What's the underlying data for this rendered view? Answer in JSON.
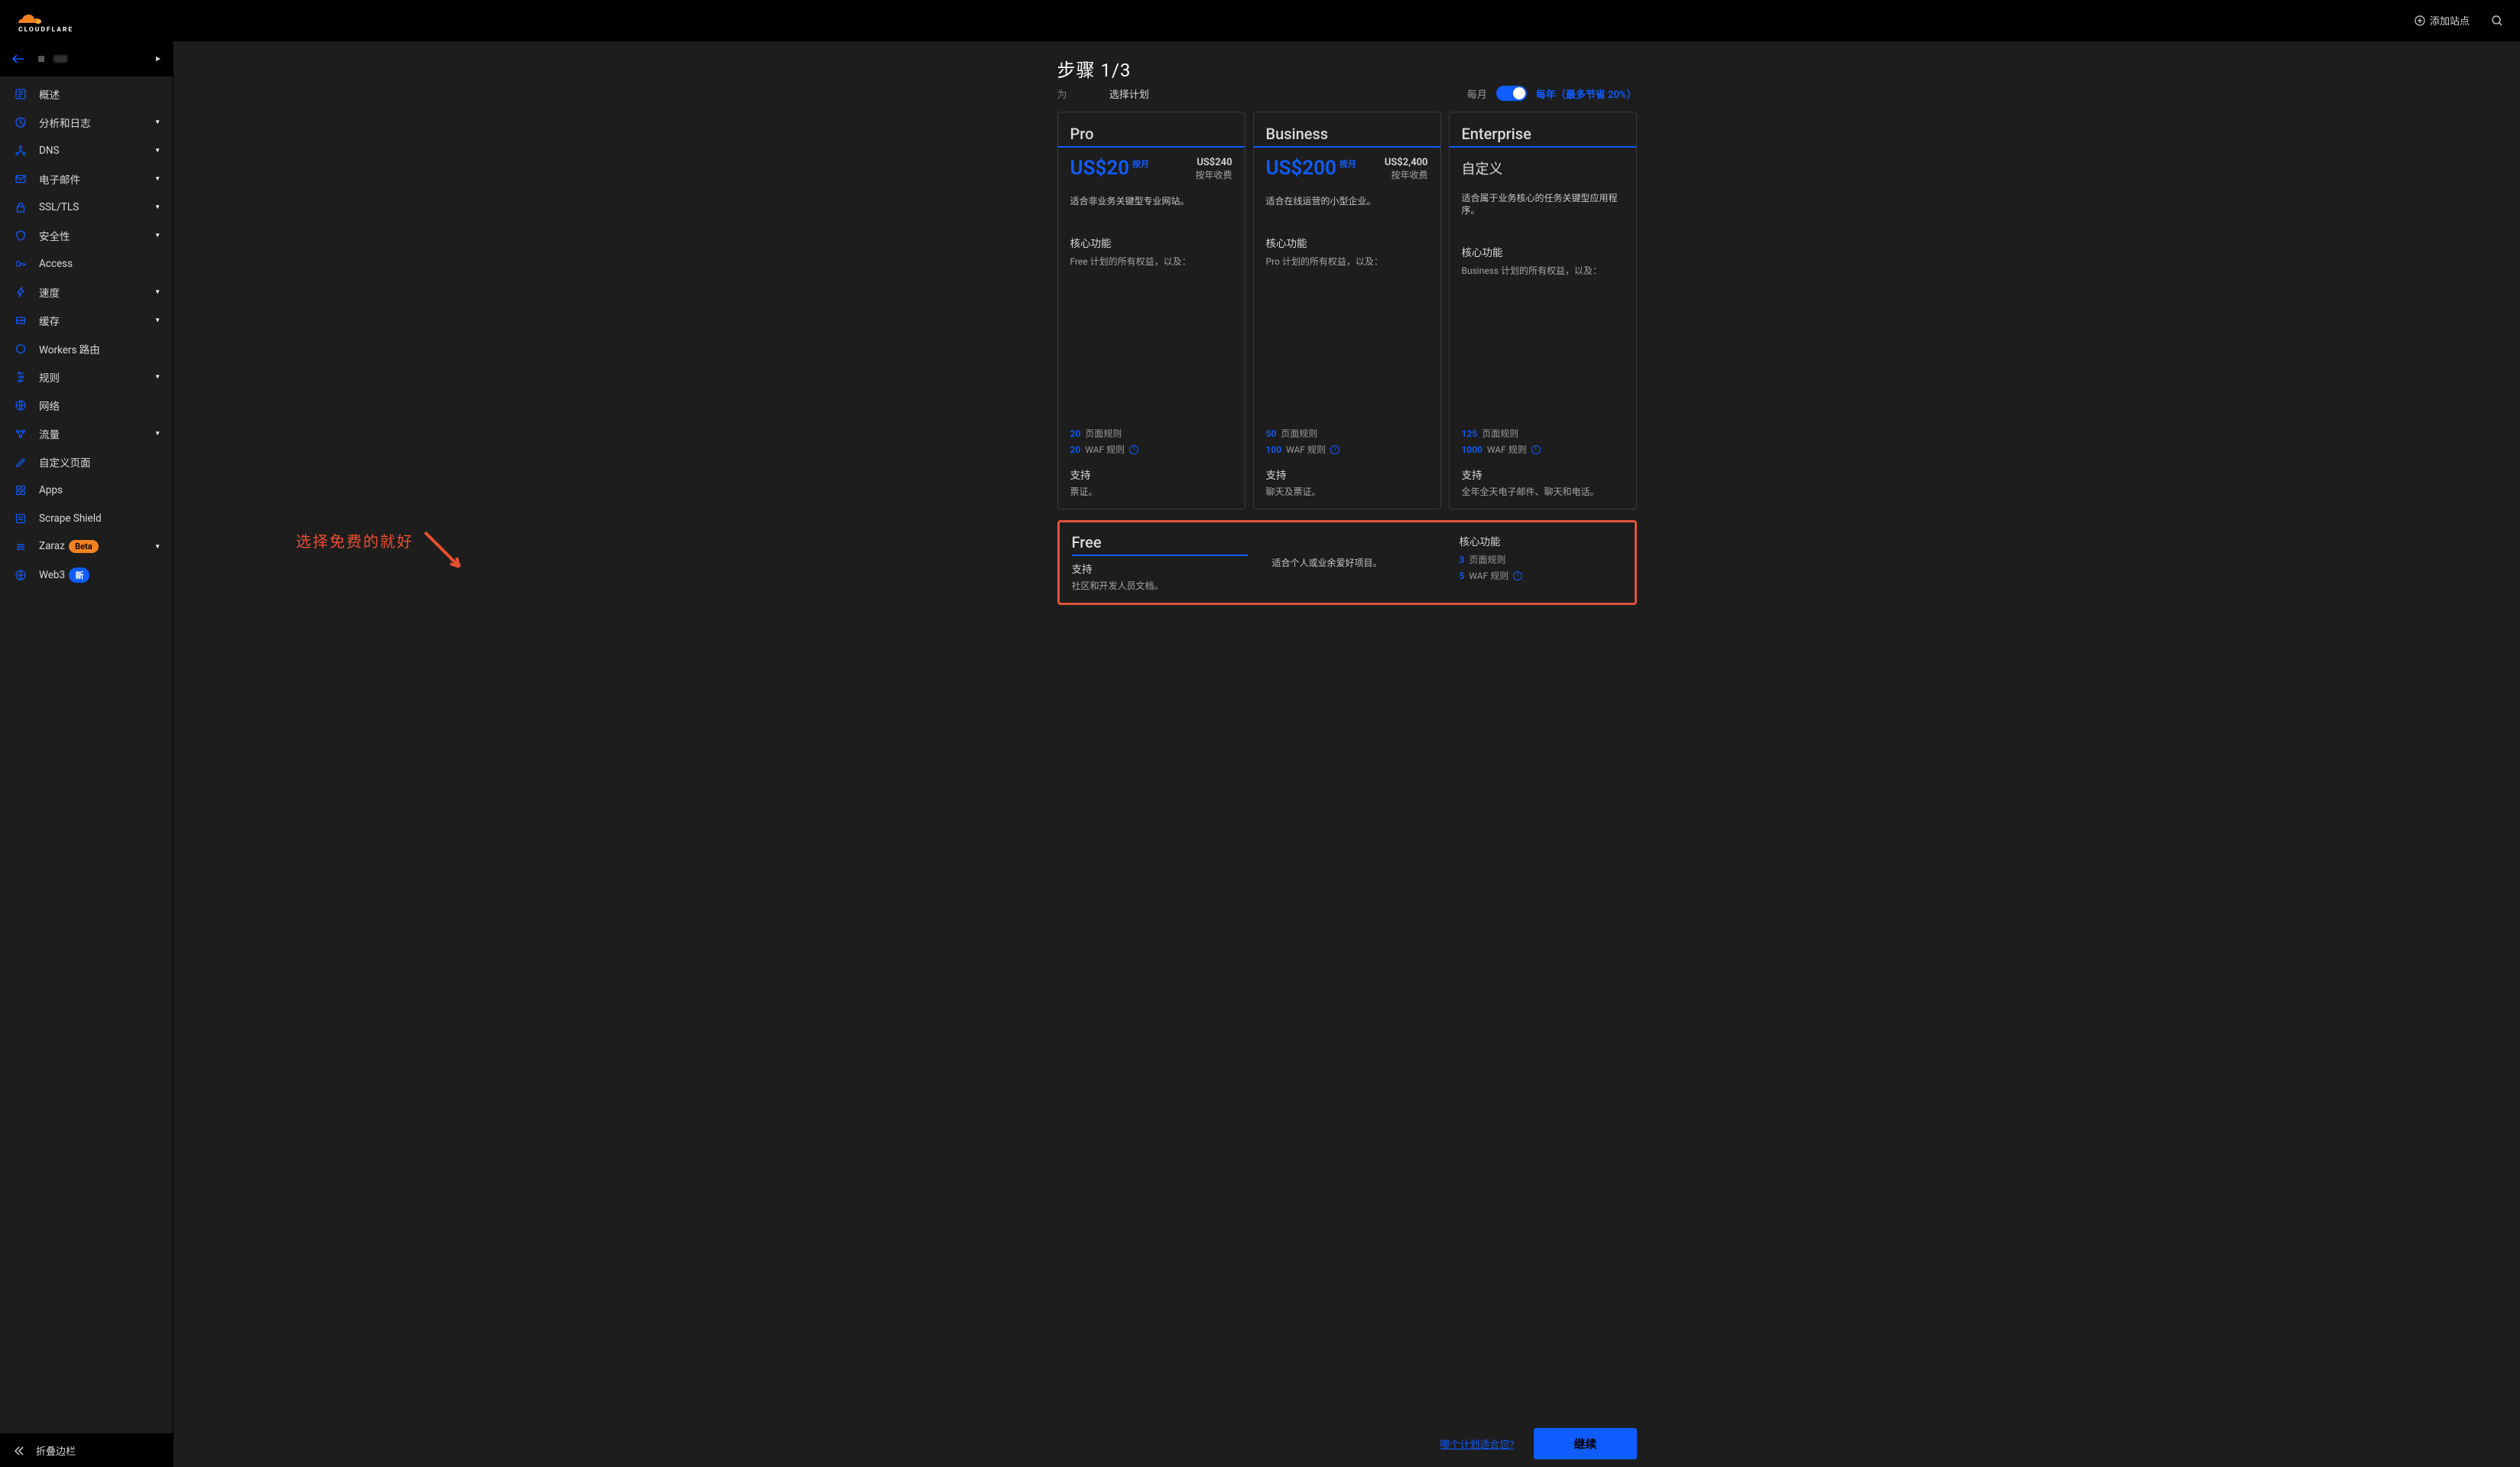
{
  "header": {
    "add_site": "添加站点"
  },
  "sidebar": {
    "items": [
      {
        "icon": "overview",
        "label": "概述",
        "expandable": false
      },
      {
        "icon": "analytics",
        "label": "分析和日志",
        "expandable": true
      },
      {
        "icon": "dns",
        "label": "DNS",
        "expandable": true
      },
      {
        "icon": "email",
        "label": "电子邮件",
        "expandable": true
      },
      {
        "icon": "lock",
        "label": "SSL/TLS",
        "expandable": true
      },
      {
        "icon": "shield",
        "label": "安全性",
        "expandable": true
      },
      {
        "icon": "access",
        "label": "Access",
        "expandable": false
      },
      {
        "icon": "speed",
        "label": "速度",
        "expandable": true
      },
      {
        "icon": "cache",
        "label": "缓存",
        "expandable": true
      },
      {
        "icon": "workers",
        "label": "Workers 路由",
        "expandable": false
      },
      {
        "icon": "rules",
        "label": "规则",
        "expandable": true
      },
      {
        "icon": "network",
        "label": "网络",
        "expandable": false
      },
      {
        "icon": "traffic",
        "label": "流量",
        "expandable": true
      },
      {
        "icon": "custom",
        "label": "自定义页面",
        "expandable": false
      },
      {
        "icon": "apps",
        "label": "Apps",
        "expandable": false
      },
      {
        "icon": "scrape",
        "label": "Scrape Shield",
        "expandable": false
      },
      {
        "icon": "zaraz",
        "label": "Zaraz",
        "expandable": true,
        "badge": "Beta",
        "badge_kind": "beta"
      },
      {
        "icon": "web3",
        "label": "Web3",
        "expandable": false,
        "badge": "新",
        "badge_kind": "new"
      }
    ],
    "collapse": "折叠边栏"
  },
  "step": {
    "title": "步骤 1/3",
    "for_label": "为",
    "select_plan": "选择计划",
    "monthly": "每月",
    "yearly": "每年（最多节省 20%）"
  },
  "plans": {
    "pro": {
      "name": "Pro",
      "price": "US$20",
      "price_unit": "按月",
      "yearly_price": "US$240",
      "yearly_note": "按年收费",
      "desc": "适合非业务关键型专业网站。",
      "core_heading": "核心功能",
      "core_sub": "Free 计划的所有权益，以及：",
      "page_rules_n": "20",
      "page_rules_l": "页面规则",
      "waf_rules_n": "20",
      "waf_rules_l": "WAF 规则",
      "support_h": "支持",
      "support_d": "票证。"
    },
    "business": {
      "name": "Business",
      "price": "US$200",
      "price_unit": "按月",
      "yearly_price": "US$2,400",
      "yearly_note": "按年收费",
      "desc": "适合在线运营的小型企业。",
      "core_heading": "核心功能",
      "core_sub": "Pro 计划的所有权益，以及：",
      "page_rules_n": "50",
      "page_rules_l": "页面规则",
      "waf_rules_n": "100",
      "waf_rules_l": "WAF 规则",
      "support_h": "支持",
      "support_d": "聊天及票证。"
    },
    "enterprise": {
      "name": "Enterprise",
      "custom": "自定义",
      "desc": "适合属于业务核心的任务关键型应用程序。",
      "core_heading": "核心功能",
      "core_sub": "Business 计划的所有权益，以及：",
      "page_rules_n": "125",
      "page_rules_l": "页面规则",
      "waf_rules_n": "1000",
      "waf_rules_l": "WAF 规则",
      "support_h": "支持",
      "support_d": "全年全天电子邮件、聊天和电话。"
    },
    "free": {
      "name": "Free",
      "desc": "适合个人或业余爱好项目。",
      "support_h": "支持",
      "support_d": "社区和开发人员文档。",
      "core_heading": "核心功能",
      "page_rules_n": "3",
      "page_rules_l": "页面规则",
      "waf_rules_n": "5",
      "waf_rules_l": "WAF 规则"
    }
  },
  "bottom": {
    "which": "哪个计划适合您?",
    "continue": "继续"
  },
  "annotation": "选择免费的就好"
}
